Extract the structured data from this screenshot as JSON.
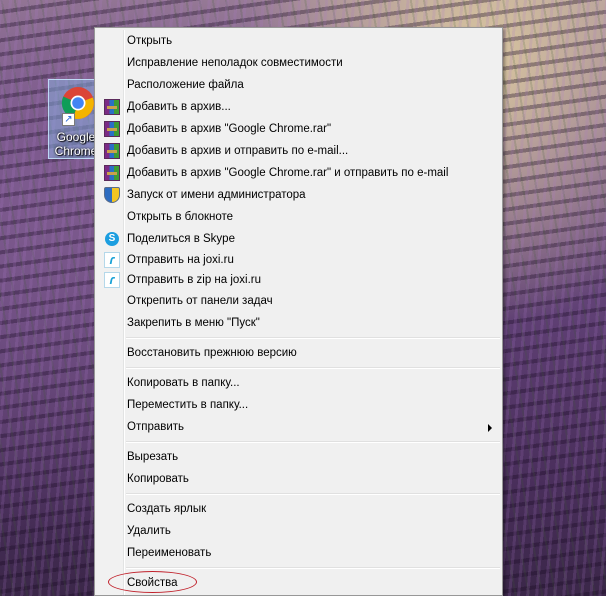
{
  "desktop_icon": {
    "label": "Google\nChrome",
    "shortcut_glyph": "↗"
  },
  "menu": {
    "items": [
      {
        "id": "open",
        "label": "Открыть",
        "icon": null
      },
      {
        "id": "compat",
        "label": "Исправление неполадок совместимости",
        "icon": null
      },
      {
        "id": "location",
        "label": "Расположение файла",
        "icon": null
      },
      {
        "id": "archive",
        "label": "Добавить в архив...",
        "icon": "winrar-icon"
      },
      {
        "id": "archive-named",
        "label": "Добавить в архив \"Google Chrome.rar\"",
        "icon": "winrar-icon"
      },
      {
        "id": "archive-email",
        "label": "Добавить в архив и отправить по e-mail...",
        "icon": "winrar-icon"
      },
      {
        "id": "archive-named-email",
        "label": "Добавить в архив \"Google Chrome.rar\" и отправить по e-mail",
        "icon": "winrar-icon"
      },
      {
        "id": "run-admin",
        "label": "Запуск от имени администратора",
        "icon": "uac-shield-icon"
      },
      {
        "id": "notepad",
        "label": "Открыть в блокноте",
        "icon": null
      },
      {
        "id": "skype",
        "label": "Поделиться в Skype",
        "icon": "skype-icon"
      },
      {
        "id": "joxi",
        "label": "Отправить на joxi.ru",
        "icon": "joxi-icon"
      },
      {
        "id": "joxi-zip",
        "label": "Отправить в zip на joxi.ru",
        "icon": "joxi-icon"
      },
      {
        "id": "unpin-taskbar",
        "label": "Открепить от панели задач",
        "icon": null
      },
      {
        "id": "pin-start",
        "label": "Закрепить в меню \"Пуск\"",
        "icon": null
      },
      {
        "id": "restore",
        "label": "Восстановить прежнюю версию",
        "icon": null
      },
      {
        "id": "copy-to",
        "label": "Копировать в папку...",
        "icon": null
      },
      {
        "id": "move-to",
        "label": "Переместить в папку...",
        "icon": null
      },
      {
        "id": "send-to",
        "label": "Отправить",
        "icon": null,
        "submenu": true
      },
      {
        "id": "cut",
        "label": "Вырезать",
        "icon": null
      },
      {
        "id": "copy",
        "label": "Копировать",
        "icon": null
      },
      {
        "id": "create-shortcut",
        "label": "Создать ярлык",
        "icon": null
      },
      {
        "id": "delete",
        "label": "Удалить",
        "icon": null
      },
      {
        "id": "rename",
        "label": "Переименовать",
        "icon": null
      },
      {
        "id": "properties",
        "label": "Свойства",
        "icon": null,
        "highlighted": true
      }
    ]
  },
  "colors": {
    "highlight_ellipse": "#c0202a",
    "skype": "#1c9ee0",
    "joxi": "#1aa2d6"
  }
}
